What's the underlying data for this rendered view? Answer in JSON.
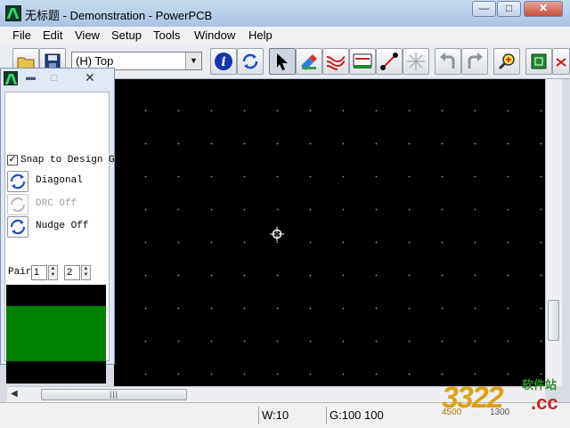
{
  "window": {
    "title": "无标题 - Demonstration - PowerPCB",
    "buttons": {
      "minimize": "—",
      "maximize": "□",
      "close": "✕"
    }
  },
  "menu": [
    "File",
    "Edit",
    "View",
    "Setup",
    "Tools",
    "Window",
    "Help"
  ],
  "toolbar": {
    "layer_value": "(H) Top"
  },
  "panel": {
    "snap_label": "Snap to Design G",
    "snap_checked": true,
    "diagonal_label": "Diagonal",
    "drc_label": "DRC Off",
    "nudge_label": "Nudge Off",
    "pair_label": "Pair",
    "pair_value_1": "1",
    "pair_value_2": "2"
  },
  "status": {
    "width": "W:10",
    "grid": "G:100 100"
  },
  "watermark": {
    "site": "软件站",
    "digits": "3322",
    "suffix": ".cc",
    "small_left": "4500",
    "small_right": "1300"
  },
  "colors": {
    "canvas": "#000000",
    "preview_fill": "#008000",
    "title_bar": "#b6cde8"
  }
}
